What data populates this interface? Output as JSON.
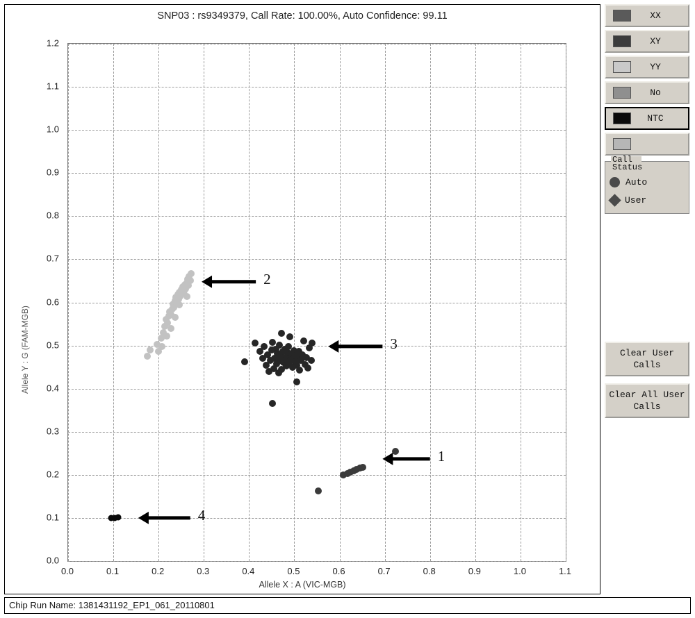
{
  "chart_panel": {
    "title": "SNP03 : rs9349379, Call Rate: 100.00%, Auto Confidence: 99.11"
  },
  "footer": {
    "text": "Chip Run Name: 1381431192_EP1_061_20110801"
  },
  "sidebar": {
    "legend_buttons": [
      {
        "label": "XX",
        "color": "#5a5a5a",
        "selected": false
      },
      {
        "label": "XY",
        "color": "#3c3c3c",
        "selected": false
      },
      {
        "label": "YY",
        "color": "#c9c9c9",
        "selected": false
      },
      {
        "label": "No",
        "color": "#8f8f8f",
        "selected": false
      },
      {
        "label": "NTC",
        "color": "#0a0a0a",
        "selected": true
      },
      {
        "label": "",
        "color": "#b6b6b6",
        "selected": false
      }
    ],
    "call_status": {
      "title": "Call Status",
      "auto_label": "Auto",
      "user_label": "User"
    },
    "clear_user_calls_label": "Clear User Calls",
    "clear_all_user_calls_label": "Clear All User Calls"
  },
  "chart_data": {
    "type": "scatter",
    "title": "SNP03 : rs9349379, Call Rate: 100.00%, Auto Confidence: 99.11",
    "xlabel": "Allele X : A (VIC-MGB)",
    "ylabel": "Allele Y : G (FAM-MGB)",
    "xlim": [
      0.0,
      1.1
    ],
    "ylim": [
      0.0,
      1.2
    ],
    "xticks": [
      "0.0",
      "0.1",
      "0.2",
      "0.3",
      "0.4",
      "0.5",
      "0.6",
      "0.7",
      "0.8",
      "0.9",
      "1.0",
      "1.1"
    ],
    "yticks": [
      "0.0",
      "0.1",
      "0.2",
      "0.3",
      "0.4",
      "0.5",
      "0.6",
      "0.7",
      "0.8",
      "0.9",
      "1.0",
      "1.1",
      "1.2"
    ],
    "grid": true,
    "legend_position": "right",
    "annotations": [
      {
        "label": "1",
        "target_x": 0.695,
        "target_y": 0.237,
        "text_x": 0.8,
        "text_y": 0.237
      },
      {
        "label": "2",
        "target_x": 0.295,
        "target_y": 0.648,
        "text_x": 0.415,
        "text_y": 0.648
      },
      {
        "label": "3",
        "target_x": 0.575,
        "target_y": 0.498,
        "text_x": 0.695,
        "text_y": 0.498
      },
      {
        "label": "4",
        "target_x": 0.155,
        "target_y": 0.1,
        "text_x": 0.27,
        "text_y": 0.1
      }
    ],
    "series": [
      {
        "name": "YY",
        "color": "#c2c2c2",
        "points": [
          [
            0.175,
            0.475
          ],
          [
            0.182,
            0.49
          ],
          [
            0.196,
            0.503
          ],
          [
            0.2,
            0.487
          ],
          [
            0.206,
            0.517
          ],
          [
            0.21,
            0.53
          ],
          [
            0.214,
            0.545
          ],
          [
            0.216,
            0.56
          ],
          [
            0.22,
            0.553
          ],
          [
            0.222,
            0.568
          ],
          [
            0.224,
            0.578
          ],
          [
            0.228,
            0.572
          ],
          [
            0.23,
            0.585
          ],
          [
            0.232,
            0.596
          ],
          [
            0.234,
            0.588
          ],
          [
            0.236,
            0.604
          ],
          [
            0.238,
            0.612
          ],
          [
            0.24,
            0.6
          ],
          [
            0.242,
            0.618
          ],
          [
            0.244,
            0.607
          ],
          [
            0.246,
            0.624
          ],
          [
            0.248,
            0.614
          ],
          [
            0.25,
            0.63
          ],
          [
            0.252,
            0.62
          ],
          [
            0.254,
            0.636
          ],
          [
            0.256,
            0.626
          ],
          [
            0.258,
            0.641
          ],
          [
            0.26,
            0.632
          ],
          [
            0.262,
            0.646
          ],
          [
            0.264,
            0.654
          ],
          [
            0.266,
            0.64
          ],
          [
            0.268,
            0.66
          ],
          [
            0.27,
            0.65
          ],
          [
            0.272,
            0.667
          ],
          [
            0.262,
            0.614
          ],
          [
            0.246,
            0.594
          ],
          [
            0.236,
            0.566
          ],
          [
            0.228,
            0.54
          ],
          [
            0.218,
            0.522
          ],
          [
            0.208,
            0.498
          ]
        ]
      },
      {
        "name": "XY",
        "color": "#262626",
        "points": [
          [
            0.39,
            0.462
          ],
          [
            0.413,
            0.506
          ],
          [
            0.424,
            0.487
          ],
          [
            0.43,
            0.47
          ],
          [
            0.434,
            0.498
          ],
          [
            0.438,
            0.455
          ],
          [
            0.441,
            0.478
          ],
          [
            0.444,
            0.44
          ],
          [
            0.447,
            0.466
          ],
          [
            0.45,
            0.489
          ],
          [
            0.452,
            0.508
          ],
          [
            0.455,
            0.446
          ],
          [
            0.457,
            0.471
          ],
          [
            0.459,
            0.492
          ],
          [
            0.461,
            0.457
          ],
          [
            0.463,
            0.481
          ],
          [
            0.465,
            0.464
          ],
          [
            0.467,
            0.501
          ],
          [
            0.469,
            0.475
          ],
          [
            0.471,
            0.444
          ],
          [
            0.472,
            0.529
          ],
          [
            0.474,
            0.487
          ],
          [
            0.476,
            0.461
          ],
          [
            0.478,
            0.472
          ],
          [
            0.48,
            0.492
          ],
          [
            0.482,
            0.452
          ],
          [
            0.483,
            0.468
          ],
          [
            0.485,
            0.484
          ],
          [
            0.487,
            0.497
          ],
          [
            0.489,
            0.458
          ],
          [
            0.491,
            0.473
          ],
          [
            0.492,
            0.466
          ],
          [
            0.494,
            0.481
          ],
          [
            0.496,
            0.449
          ],
          [
            0.498,
            0.471
          ],
          [
            0.5,
            0.488
          ],
          [
            0.502,
            0.462
          ],
          [
            0.504,
            0.476
          ],
          [
            0.506,
            0.455
          ],
          [
            0.508,
            0.469
          ],
          [
            0.51,
            0.487
          ],
          [
            0.512,
            0.443
          ],
          [
            0.515,
            0.465
          ],
          [
            0.518,
            0.478
          ],
          [
            0.521,
            0.511
          ],
          [
            0.524,
            0.456
          ],
          [
            0.527,
            0.472
          ],
          [
            0.53,
            0.447
          ],
          [
            0.533,
            0.495
          ],
          [
            0.537,
            0.466
          ],
          [
            0.54,
            0.506
          ],
          [
            0.49,
            0.52
          ],
          [
            0.465,
            0.437
          ],
          [
            0.505,
            0.415
          ],
          [
            0.452,
            0.366
          ]
        ]
      },
      {
        "name": "XX",
        "color": "#3b3b3b",
        "points": [
          [
            0.608,
            0.199
          ],
          [
            0.617,
            0.203
          ],
          [
            0.624,
            0.206
          ],
          [
            0.631,
            0.21
          ],
          [
            0.638,
            0.213
          ],
          [
            0.645,
            0.216
          ],
          [
            0.652,
            0.218
          ],
          [
            0.723,
            0.254
          ],
          [
            0.553,
            0.163
          ]
        ]
      },
      {
        "name": "NTC",
        "color": "#0a0a0a",
        "points": [
          [
            0.096,
            0.1
          ],
          [
            0.103,
            0.1
          ],
          [
            0.11,
            0.101
          ]
        ]
      }
    ]
  }
}
